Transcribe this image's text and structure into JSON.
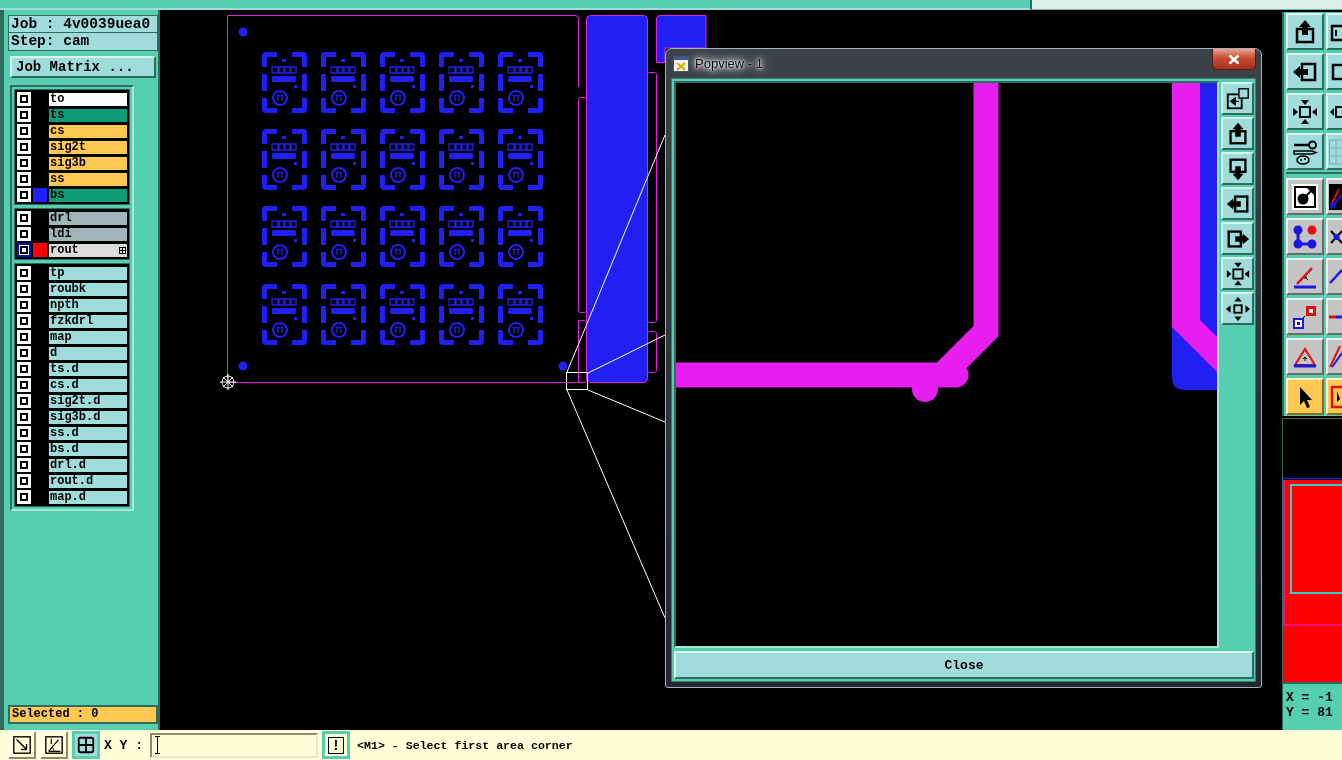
{
  "job_panel": {
    "job": "Job : 4v0039uea0",
    "step": "Step: cam",
    "matrix_button": "Job Matrix ..."
  },
  "layer_groups": [
    {
      "layers": [
        {
          "name": "to",
          "kind": "silk",
          "selected": false
        },
        {
          "name": "ts",
          "kind": "mask",
          "selected": false
        },
        {
          "name": "cs",
          "kind": "signal",
          "selected": false
        },
        {
          "name": "sig2t",
          "kind": "signal",
          "selected": false
        },
        {
          "name": "sig3b",
          "kind": "signal",
          "selected": false
        },
        {
          "name": "ss",
          "kind": "signal",
          "selected": false
        },
        {
          "name": "bs",
          "kind": "mask",
          "color": "#2020ff",
          "selected": false
        }
      ]
    },
    {
      "layers": [
        {
          "name": "drl",
          "kind": "drill",
          "selected": false
        },
        {
          "name": "ldi",
          "kind": "drill",
          "selected": false
        },
        {
          "name": "rout",
          "kind": "rout",
          "color": "#ff0000",
          "selected": true
        }
      ]
    },
    {
      "layers": [
        {
          "name": "tp",
          "kind": "document",
          "selected": false
        },
        {
          "name": "roubk",
          "kind": "document",
          "selected": false
        },
        {
          "name": "npth",
          "kind": "document",
          "selected": false
        },
        {
          "name": "fzkdrl",
          "kind": "document",
          "selected": false
        },
        {
          "name": "map",
          "kind": "document",
          "selected": false
        },
        {
          "name": "d",
          "kind": "document",
          "selected": false
        },
        {
          "name": "ts.d",
          "kind": "document",
          "selected": false
        },
        {
          "name": "cs.d",
          "kind": "document",
          "selected": false
        },
        {
          "name": "sig2t.d",
          "kind": "document",
          "selected": false
        },
        {
          "name": "sig3b.d",
          "kind": "document",
          "selected": false
        },
        {
          "name": "ss.d",
          "kind": "document",
          "selected": false
        },
        {
          "name": "bs.d",
          "kind": "document",
          "selected": false
        },
        {
          "name": "drl.d",
          "kind": "document",
          "selected": false
        },
        {
          "name": "rout.d",
          "kind": "document",
          "selected": false
        },
        {
          "name": "map.d",
          "kind": "document",
          "selected": false
        }
      ]
    }
  ],
  "selected_count": "Selected : 0",
  "tool_rows": [
    {
      "selected": false
    },
    {
      "selected": false
    },
    {
      "selected": false
    },
    {
      "selected": false
    },
    {
      "selected": false
    },
    {
      "selected": false
    },
    {
      "selected": false
    },
    {
      "selected": false
    },
    {
      "selected": false
    },
    {
      "selected": true
    }
  ],
  "overview": {
    "x_reading": "X = -1",
    "y_reading": "Y = 81"
  },
  "popview": {
    "title": "Popview - 1",
    "close_button": "Close"
  },
  "bottom_bar": {
    "snap_buttons": [
      {
        "selected": false
      },
      {
        "selected": false
      },
      {
        "selected": true
      }
    ],
    "xy_label": "X Y :",
    "alert_button": "!",
    "message": "<M1> - Select first area corner"
  }
}
